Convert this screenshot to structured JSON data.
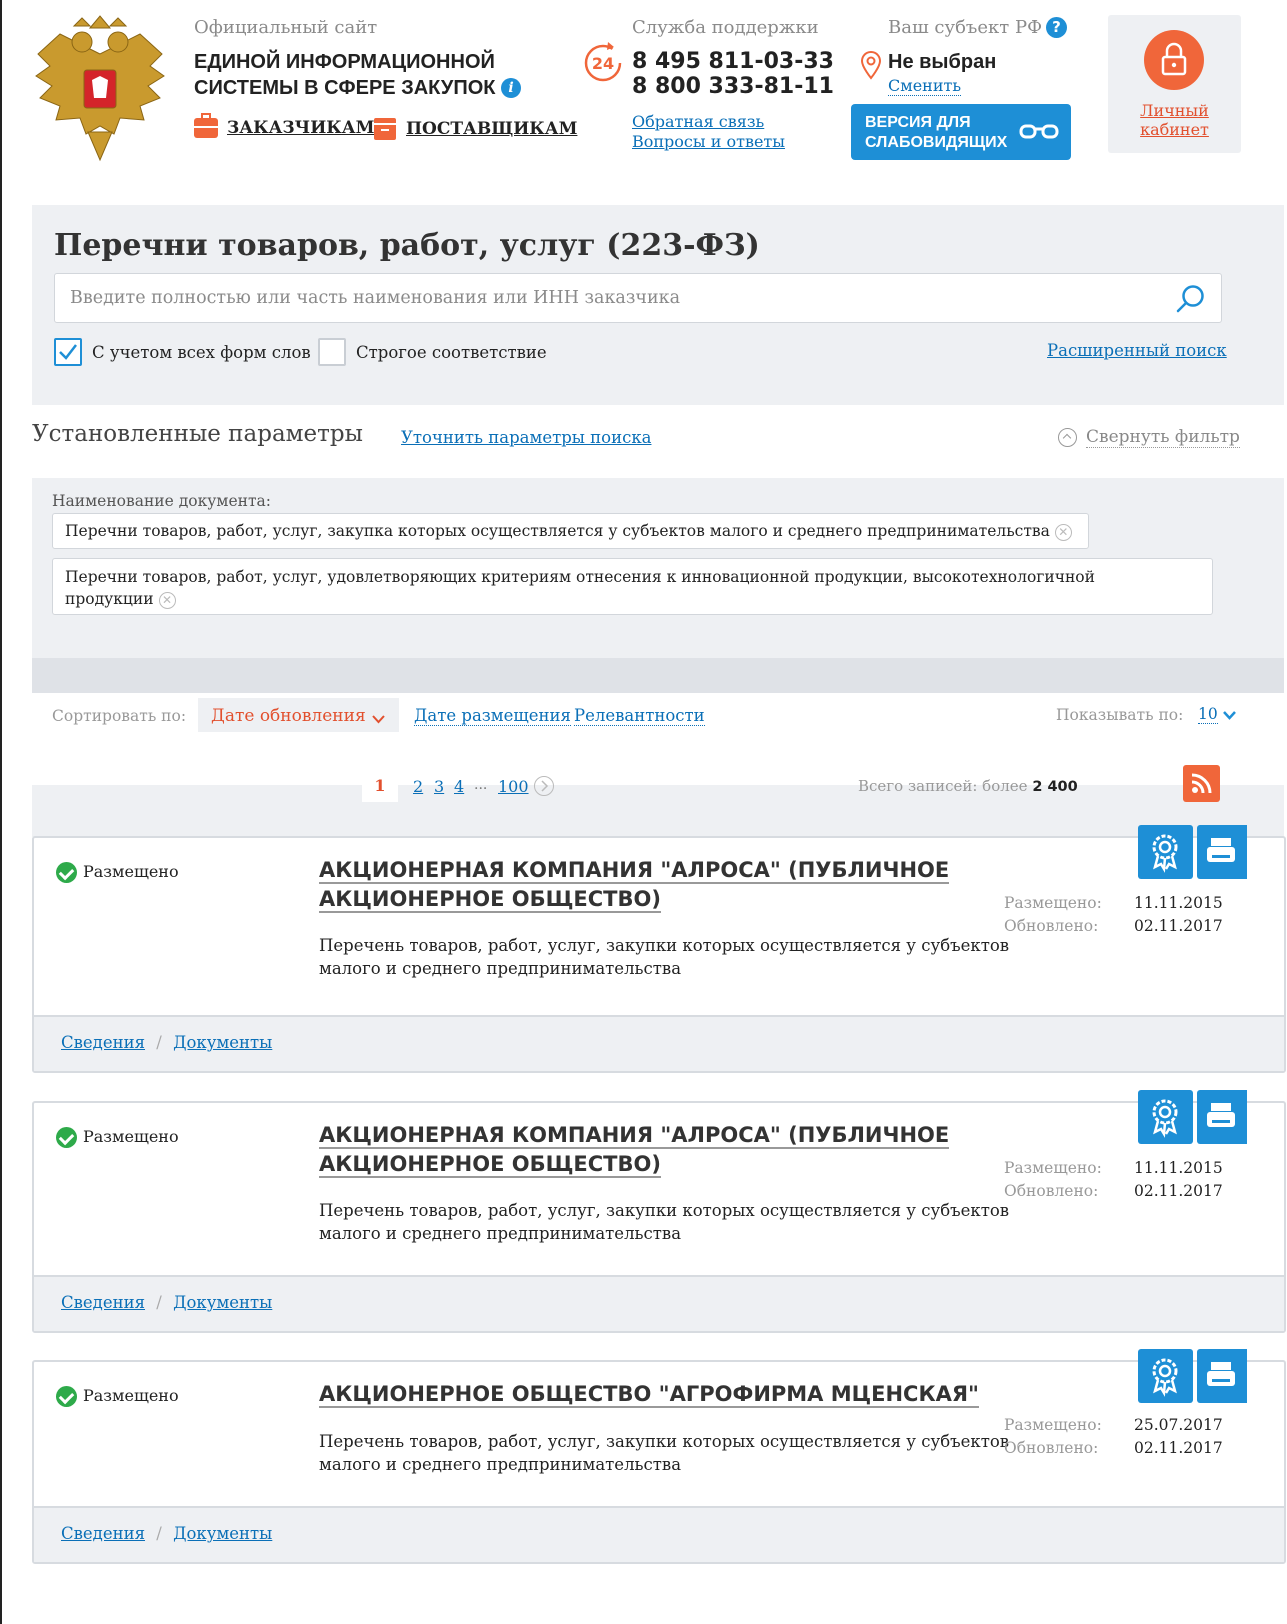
{
  "header": {
    "official": "Официальный сайт",
    "title_line1": "ЕДИНОЙ ИНФОРМАЦИОННОЙ",
    "title_line2": "СИСТЕМЫ В СФЕРЕ ЗАКУПОК",
    "nav_customers": "ЗАКАЗЧИКАМ",
    "nav_suppliers": "ПОСТАВЩИКАМ",
    "support_label": "Служба поддержки",
    "support_badge": "24",
    "phone1": "8 495 811-03-33",
    "phone2": "8 800 333-81-11",
    "feedback": "Обратная связь",
    "faq": "Вопросы и ответы",
    "region_label": "Ваш субъект РФ",
    "region_value": "Не выбран",
    "region_change": "Сменить",
    "vision_line1": "ВЕРСИЯ ДЛЯ",
    "vision_line2": "СЛАБОВИДЯЩИХ",
    "cabinet_line1": "Личный",
    "cabinet_line2": "кабинет"
  },
  "search": {
    "title": "Перечни товаров, работ, услуг (223-ФЗ)",
    "placeholder": "Введите полностью или часть наименования или ИНН заказчика",
    "all_forms": "С учетом всех форм слов",
    "strict": "Строгое соответствие",
    "advanced": "Расширенный поиск"
  },
  "params": {
    "title": "Установленные параметры",
    "refine": "Уточнить параметры поиска",
    "collapse": "Свернуть фильтр",
    "doc_label": "Наименование документа:",
    "tag1": "Перечни товаров, работ, услуг, закупка которых осуществляется у субъектов малого и среднего предпринимательства",
    "tag2_line1": "Перечни товаров, работ, услуг, удовлетворяющих критериям отнесения к инновационной продукции, высокотехнологичной",
    "tag2_line2": "продукции"
  },
  "sort": {
    "label": "Сортировать по:",
    "selected": "Дате обновления",
    "opt2": "Дате размещения",
    "opt3": "Релевантности",
    "show_label": "Показывать по:",
    "show_value": "10"
  },
  "pager": {
    "current": "1",
    "p2": "2",
    "p3": "3",
    "p4": "4",
    "dots": "...",
    "last": "100",
    "total_label": "Всего записей: более",
    "total_value": "2 400"
  },
  "cards": [
    {
      "status": "Размещено",
      "org_line1": "АКЦИОНЕРНАЯ КОМПАНИЯ \"АЛРОСА\" (ПУБЛИЧНОЕ",
      "org_line2": "АКЦИОНЕРНОЕ ОБЩЕСТВО)",
      "desc_line1": "Перечень товаров, работ, услуг, закупки которых осуществляется у субъектов",
      "desc_line2": "малого и среднего предпринимательства",
      "posted_label": "Размещено:",
      "posted": "11.11.2015",
      "updated_label": "Обновлено:",
      "updated": "02.11.2017",
      "link1": "Сведения",
      "sep": "/",
      "link2": "Документы"
    },
    {
      "status": "Размещено",
      "org_line1": "АКЦИОНЕРНАЯ КОМПАНИЯ \"АЛРОСА\" (ПУБЛИЧНОЕ",
      "org_line2": "АКЦИОНЕРНОЕ ОБЩЕСТВО)",
      "desc_line1": "Перечень товаров, работ, услуг, закупки которых осуществляется у субъектов",
      "desc_line2": "малого и среднего предпринимательства",
      "posted_label": "Размещено:",
      "posted": "11.11.2015",
      "updated_label": "Обновлено:",
      "updated": "02.11.2017",
      "link1": "Сведения",
      "sep": "/",
      "link2": "Документы"
    },
    {
      "status": "Размещено",
      "org_line1": "АКЦИОНЕРНОЕ ОБЩЕСТВО \"АГРОФИРМА МЦЕНСКАЯ\"",
      "org_line2": "",
      "desc_line1": "Перечень товаров, работ, услуг, закупки которых осуществляется у субъектов",
      "desc_line2": "малого и среднего предпринимательства",
      "posted_label": "Размещено:",
      "posted": "25.07.2017",
      "updated_label": "Обновлено:",
      "updated": "02.11.2017",
      "link1": "Сведения",
      "sep": "/",
      "link2": "Документы"
    }
  ],
  "colors": {
    "accent_blue": "#1e8fd6",
    "accent_orange": "#f0663a",
    "status_green": "#2eaa4a",
    "panel_grey": "#eef0f3"
  },
  "icons": [
    "emblem-icon",
    "info-icon",
    "briefcase-icon",
    "box-icon",
    "support-24-icon",
    "location-pin-icon",
    "help-icon",
    "glasses-icon",
    "lock-icon",
    "search-icon",
    "checkbox-checked-icon",
    "collapse-icon",
    "clear-icon",
    "chevron-down-icon",
    "next-page-icon",
    "rss-icon",
    "check-circle-icon",
    "certificate-icon",
    "print-icon"
  ]
}
